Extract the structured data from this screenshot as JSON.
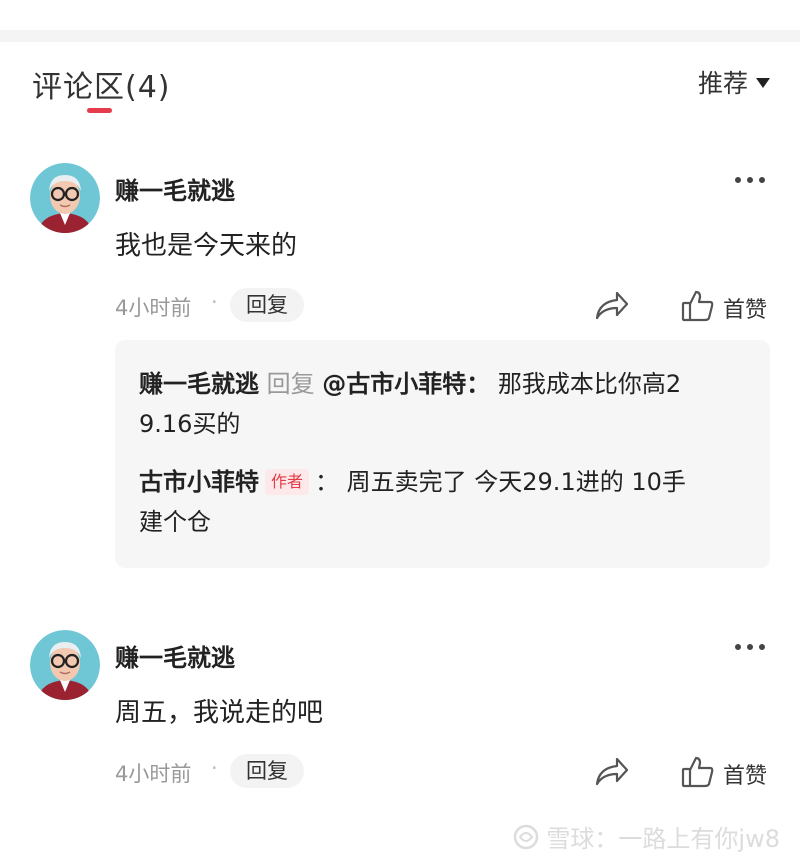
{
  "header": {
    "title": "评论区(4)",
    "sort_label": "推荐"
  },
  "comments": [
    {
      "username": "赚一毛就逃",
      "content": "我也是今天来的",
      "time": "4小时前",
      "dot": "·",
      "reply_label": "回复",
      "like_label": "首赞",
      "replies": [
        {
          "user": "赚一毛就逃",
          "mid": "回复",
          "at": "@古市小菲特：",
          "text_line1": " 那我成本比你高2",
          "text_line2": "9.16买的"
        },
        {
          "user": "古市小菲特",
          "tag": "作者",
          "sep": "：",
          "text_line1": " 周五卖完了 今天29.1进的 10手",
          "text_line2": "建个仓"
        }
      ]
    },
    {
      "username": "赚一毛就逃",
      "content": "周五，我说走的吧",
      "time": "4小时前",
      "dot": "·",
      "reply_label": "回复",
      "like_label": "首赞"
    }
  ],
  "watermark": "雪球：一路上有你jw8",
  "colors": {
    "accent": "#e53b4a",
    "muted": "#999999",
    "reply_bg": "#f6f6f6"
  }
}
